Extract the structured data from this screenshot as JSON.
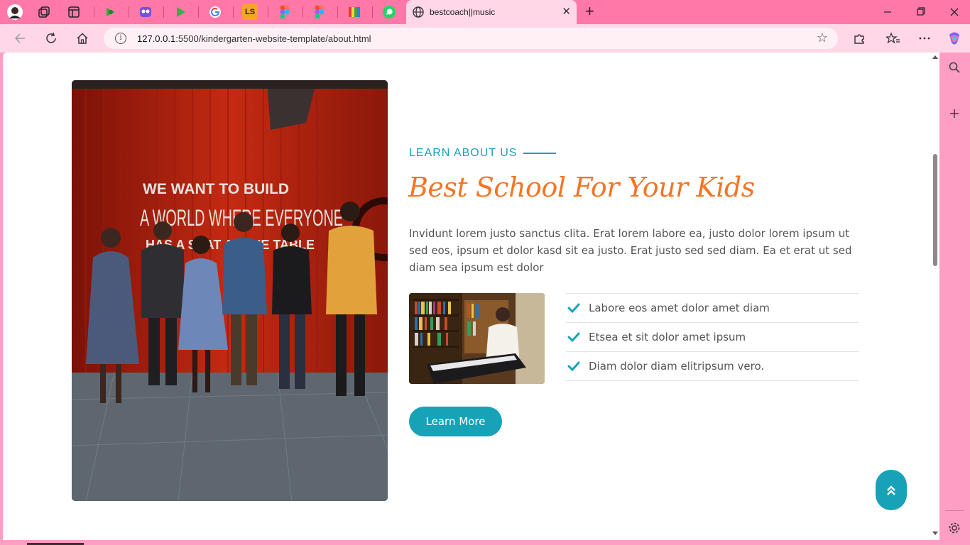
{
  "browser": {
    "tab_title": "bestcoach||music",
    "tab_icons": [
      "profile-avatar-icon",
      "workspaces-icon",
      "tab-actions-icon",
      "green-arrow-icon",
      "mask-icon",
      "play-icon",
      "google-icon",
      "ls-icon",
      "figma-icon",
      "figma-icon",
      "stripes-icon",
      "whatsapp-icon"
    ],
    "ls_label": "LS",
    "close_tab_label": "✕",
    "new_tab_label": "+",
    "url_host": "127.0.0.1",
    "url_path": ":5500/kindergarten-website-template/about.html",
    "colors": {
      "tabstrip": "#ff78a8",
      "toolbar": "#ffd7e6",
      "frame": "#ff9ec4"
    }
  },
  "about": {
    "section_tag": "LEARN ABOUT US",
    "heading": "Best School For Your Kids",
    "description": "Invidunt lorem justo sanctus clita. Erat lorem labore ea, justo dolor lorem ipsum ut sed eos, ipsum et dolor kasd sit ea justo. Erat justo sed sed diam. Ea et erat ut sed diam sea ipsum est dolor",
    "checklist": [
      {
        "text": "Labore eos amet dolor amet diam"
      },
      {
        "text": "Etsea et sit dolor amet ipsum"
      },
      {
        "text": "Diam dolor diam elitripsum vero."
      }
    ],
    "button_label": "Learn More",
    "photo_wall_text": [
      "WE WANT TO BUILD",
      "A WORLD WHERE EVERYONE",
      "HAS A SEAT AT THE TABLE"
    ],
    "colors": {
      "accent": "#17a2b8",
      "heading": "#f47524",
      "text": "#555555"
    }
  }
}
